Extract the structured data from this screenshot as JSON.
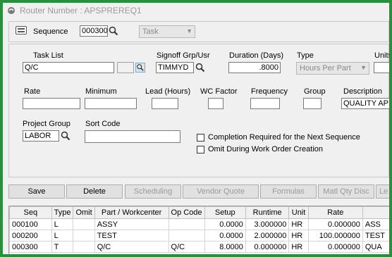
{
  "window": {
    "title": "Router Number : APSPREREQ1"
  },
  "header": {
    "sequence_label": "Sequence",
    "sequence_value": "000300",
    "type_combo_value": "Task"
  },
  "form": {
    "task_list_label": "Task List",
    "task_list_value": "Q/C",
    "signoff_label": "Signoff Grp/Usr",
    "signoff_value": "TIMMYD",
    "duration_label": "Duration (Days)",
    "duration_value": ".8000",
    "type_label": "Type",
    "type_value": "Hours Per Part",
    "units_label": "Units",
    "rate_label": "Rate",
    "minimum_label": "Minimum",
    "lead_label": "Lead (Hours)",
    "wc_factor_label": "WC Factor",
    "frequency_label": "Frequency",
    "group_label": "Group",
    "description_label": "Description",
    "description_value": "QUALITY APPR",
    "project_group_label": "Project Group",
    "project_group_value": "LABOR",
    "sort_code_label": "Sort Code",
    "completion_required_label": "Completion Required for the Next Sequence",
    "omit_label": "Omit During Work Order Creation"
  },
  "buttons": {
    "save": "Save",
    "delete": "Delete",
    "scheduling": "Scheduling",
    "vendor_quote": "Vendor Quote",
    "formulas": "Formulas",
    "matl_qty_disc": "Matl Qty Disc",
    "more": "Le"
  },
  "grid": {
    "columns": [
      "Seq",
      "Type",
      "Omit",
      "Part / Workcenter",
      "Op Code",
      "Setup",
      "Runtime",
      "Unit",
      "Rate",
      ""
    ],
    "rows": [
      [
        "000100",
        "L",
        "",
        "ASSY",
        "",
        "0.0000",
        "3.000000",
        "HR",
        "0.000000",
        "ASS"
      ],
      [
        "000200",
        "L",
        "",
        "TEST",
        "",
        "0.0000",
        "2.000000",
        "HR",
        "100.000000",
        "TEST"
      ],
      [
        "000300",
        "T",
        "",
        "Q/C",
        "Q/C",
        "8.0000",
        "0.000000",
        "HR",
        "0.000000",
        "QUA"
      ]
    ]
  }
}
